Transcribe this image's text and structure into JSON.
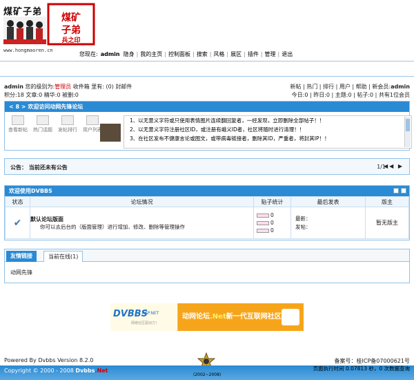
{
  "header": {
    "logo_text": "煤矿子弟",
    "logo_seal": "煤矿子弟兵之印",
    "logo_url": "www.hongmaoren.cn"
  },
  "topnav": {
    "welcome": "您现在:",
    "username": "admin",
    "items": [
      "隐身",
      "我的主页",
      "控制面板",
      "搜索",
      "风格",
      "展区",
      "插件",
      "管理",
      "退出"
    ]
  },
  "userbar": {
    "line1_user": "admin",
    "line1_prefix": "您的级别为:",
    "line1_level": "管理员",
    "line1_rest": "收件箱 里有: (0) 封邮件",
    "line1_links": [
      "新帖",
      "热门",
      "排行",
      "用户",
      "帮助"
    ],
    "line1_newmember_label": "新会员:",
    "line1_newmember": "admin",
    "line2_left": "积分:18  文章:0  精华:0  被删:0",
    "line2_right": "今日:0 | 昨日:0 | 主题:0 | 帖子:0 | 共有1位会员"
  },
  "welcome_panel": {
    "title": "< 8 > 欢迎访问动网先锋论坛",
    "icons": [
      "查看新帖",
      "热门话题",
      "发帖排行",
      "用户列表"
    ],
    "notices": [
      "1、以无意义字符或只使用表情图片连续翻回复者，一经发现，立即删除全部帖子！！",
      "2、以无意义字符注册社区ID，或注册有峨义ID者，社区将随时进行清理！！",
      "3、在社区发布不健康言论或图文，或带病毒链接者，删除其ID，严重者，将封其IP！！"
    ]
  },
  "announcement": {
    "text": "公告：  当前还未有公告",
    "pager": "1/1",
    "arrows": "◀◀ ▶"
  },
  "forum": {
    "title": "欢迎使用DVBBS",
    "headers": [
      "状态",
      "论坛情况",
      "贴子统计",
      "最后发表",
      "版主"
    ],
    "row": {
      "name": "默认论坛版面",
      "desc": "你可以去后台的（版面管理）进行增加、修改、删除等管理操作",
      "stats": [
        "0",
        "0",
        "0"
      ],
      "last_new": "最新：",
      "last_poster": "发帖：",
      "moderator": "暂无版主"
    }
  },
  "tabs": {
    "items": [
      "友情链接",
      "当前在线(1)"
    ],
    "content": "动网先锋"
  },
  "banner": {
    "brand": "DVBBS",
    "sub": "ASP.NET",
    "small": "网络社区驱动力！",
    "slogan_a": "动网论坛",
    "slogan_b": ".Net",
    "slogan_c": "新一代互联网社区体验"
  },
  "footer": {
    "powered": "Powered By Dvbbs Version 8.2.0",
    "icp": "备案号：桂ICP备07000621号",
    "copyright_a": "Copyright © 2000 - 2008",
    "copyright_b": "Dvbbs",
    "copyright_c": ".Net",
    "exec": "页面执行时间  0.07813 秒，0 次数据查询",
    "years": "(2002~2008)"
  },
  "colors": {
    "accent": "#2a8ad4",
    "border": "#8fc1e8",
    "admin_red": "#cc0000",
    "banner_orange": "#f6a51b"
  }
}
